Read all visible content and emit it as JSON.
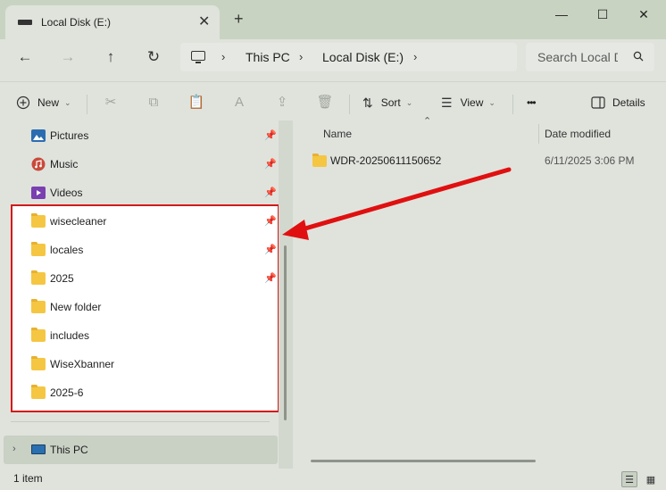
{
  "window": {
    "tab_title": "Local Disk (E:)",
    "new_tab_symbol": "+",
    "close_tab_symbol": "✕",
    "minimize_symbol": "—",
    "maximize_symbol": "☐",
    "close_symbol": "✕"
  },
  "navigation": {
    "back_symbol": "←",
    "forward_symbol": "→",
    "up_symbol": "↑",
    "refresh_symbol": "↻",
    "breadcrumb": [
      "This PC",
      "Local Disk (E:)"
    ],
    "search_placeholder": "Search Local D"
  },
  "toolbar": {
    "new_label": "New",
    "sort_label": "Sort",
    "view_label": "View",
    "more_label": "•••",
    "details_label": "Details"
  },
  "sidebar": {
    "items": [
      {
        "label": "Pictures",
        "icon": "pictures-icon",
        "pinned": true
      },
      {
        "label": "Music",
        "icon": "music-icon",
        "pinned": true
      },
      {
        "label": "Videos",
        "icon": "videos-icon",
        "pinned": true
      },
      {
        "label": "wisecleaner",
        "icon": "folder-icon",
        "pinned": true
      },
      {
        "label": "locales",
        "icon": "folder-icon",
        "pinned": true
      },
      {
        "label": "2025",
        "icon": "folder-icon",
        "pinned": true
      },
      {
        "label": "New folder",
        "icon": "folder-icon",
        "pinned": false
      },
      {
        "label": "includes",
        "icon": "folder-icon",
        "pinned": false
      },
      {
        "label": "WiseXbanner",
        "icon": "folder-icon",
        "pinned": false
      },
      {
        "label": "2025-6",
        "icon": "folder-icon",
        "pinned": false
      }
    ],
    "this_pc_label": "This PC"
  },
  "file_list": {
    "columns": {
      "name": "Name",
      "date_modified": "Date modified"
    },
    "rows": [
      {
        "name": "WDR-20250611150652",
        "date_modified": "6/11/2025 3:06 PM"
      }
    ]
  },
  "status": {
    "item_count": "1 item"
  },
  "colors": {
    "accent_red": "#d21a1a",
    "folder_yellow": "#f5c642",
    "background": "#dfe3dc"
  }
}
